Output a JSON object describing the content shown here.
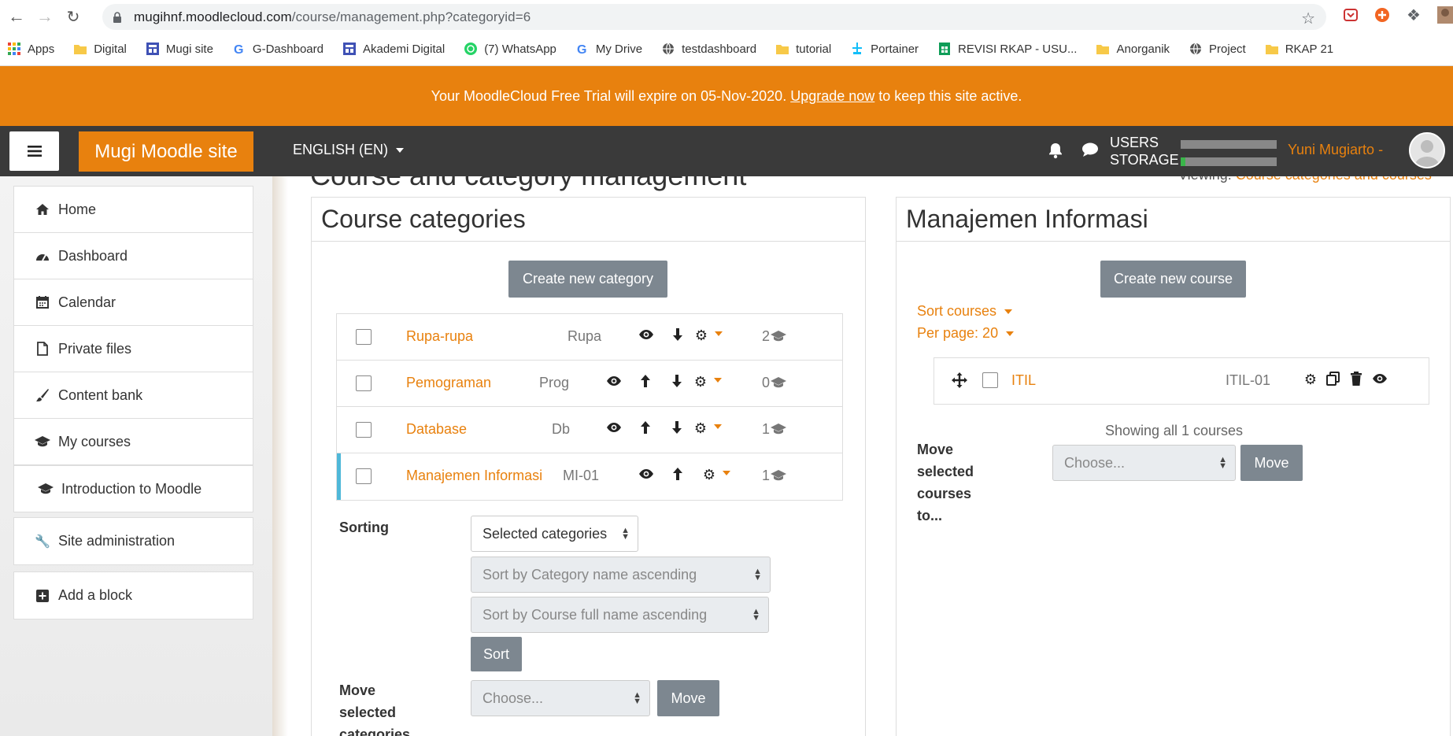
{
  "browser": {
    "url_host": "mugihnf.moodlecloud.com",
    "url_path": "/course/management.php?categoryid=6",
    "bookmarks": [
      {
        "label": "Apps",
        "icon": "apps-grid-icon"
      },
      {
        "label": "Digital",
        "icon": "folder-icon"
      },
      {
        "label": "Mugi site",
        "icon": "moodle-site-icon"
      },
      {
        "label": "G-Dashboard",
        "icon": "google-icon"
      },
      {
        "label": "Akademi Digital",
        "icon": "moodle-site-icon"
      },
      {
        "label": "(7) WhatsApp",
        "icon": "whatsapp-icon"
      },
      {
        "label": "My Drive",
        "icon": "google-icon"
      },
      {
        "label": "testdashboard",
        "icon": "globe-icon"
      },
      {
        "label": "tutorial",
        "icon": "folder-icon"
      },
      {
        "label": "Portainer",
        "icon": "portainer-icon"
      },
      {
        "label": "REVISI RKAP - USU...",
        "icon": "sheets-icon"
      },
      {
        "label": "Anorganik",
        "icon": "folder-icon"
      },
      {
        "label": "Project",
        "icon": "globe-icon"
      },
      {
        "label": "RKAP 21",
        "icon": "folder-icon"
      }
    ]
  },
  "banner": {
    "text_before": "Your MoodleCloud Free Trial will expire on 05-Nov-2020.",
    "link": "Upgrade now",
    "text_after": "to keep this site active."
  },
  "navbar": {
    "site_name": "Mugi Moodle site",
    "language": "ENGLISH (EN)",
    "usage_users": "USERS",
    "usage_storage": "STORAGE",
    "user_name": "Yuni Mugiarto -",
    "storage_fraction": 0.05
  },
  "drawer": {
    "main": [
      {
        "label": "Home",
        "icon": "home-icon"
      },
      {
        "label": "Dashboard",
        "icon": "dashboard-icon"
      },
      {
        "label": "Calendar",
        "icon": "calendar-icon"
      },
      {
        "label": "Private files",
        "icon": "file-icon"
      },
      {
        "label": "Content bank",
        "icon": "brush-icon"
      },
      {
        "label": "My courses",
        "icon": "graduation-cap-icon"
      },
      {
        "label": "Introduction to Moodle",
        "icon": "graduation-cap-icon"
      }
    ],
    "admin": {
      "label": "Site administration",
      "icon": "wrench-icon"
    },
    "add_block": {
      "label": "Add a block",
      "icon": "plus-square-icon"
    }
  },
  "page": {
    "title": "Course and category management",
    "viewing_label": "Viewing:",
    "viewing_value": "Course categories and courses"
  },
  "categories_panel": {
    "title": "Course categories",
    "create_button": "Create new category",
    "rows": [
      {
        "name": "Rupa-rupa",
        "idnumber": "Rupa",
        "count": "2",
        "up": false,
        "down": true,
        "active": false
      },
      {
        "name": "Pemograman",
        "idnumber": "Prog",
        "count": "0",
        "up": true,
        "down": true,
        "active": false
      },
      {
        "name": "Database",
        "idnumber": "Db",
        "count": "1",
        "up": true,
        "down": true,
        "active": false
      },
      {
        "name": "Manajemen Informasi",
        "idnumber": "MI-01",
        "count": "1",
        "up": true,
        "down": false,
        "active": true
      }
    ],
    "sorting_label": "Sorting",
    "sorting_select": "Selected categories",
    "sort_by_category": "Sort by Category name ascending",
    "sort_by_course": "Sort by Course full name ascending",
    "sort_button": "Sort",
    "move_label": "Move selected categories to...",
    "move_select": "Choose...",
    "move_button": "Move"
  },
  "course_panel": {
    "title": "Manajemen Informasi",
    "create_button": "Create new course",
    "sort_courses": "Sort courses",
    "per_page": "Per page: 20",
    "course": {
      "name": "ITIL",
      "idnumber": "ITIL-01"
    },
    "showing": "Showing all 1 courses",
    "move_label": "Move selected courses to...",
    "move_select": "Choose...",
    "move_button": "Move"
  },
  "colors": {
    "accent": "#e8810e",
    "navbar": "#3a3a3a",
    "active_bar": "#4fb8d9",
    "button_gray": "#7d8790"
  }
}
